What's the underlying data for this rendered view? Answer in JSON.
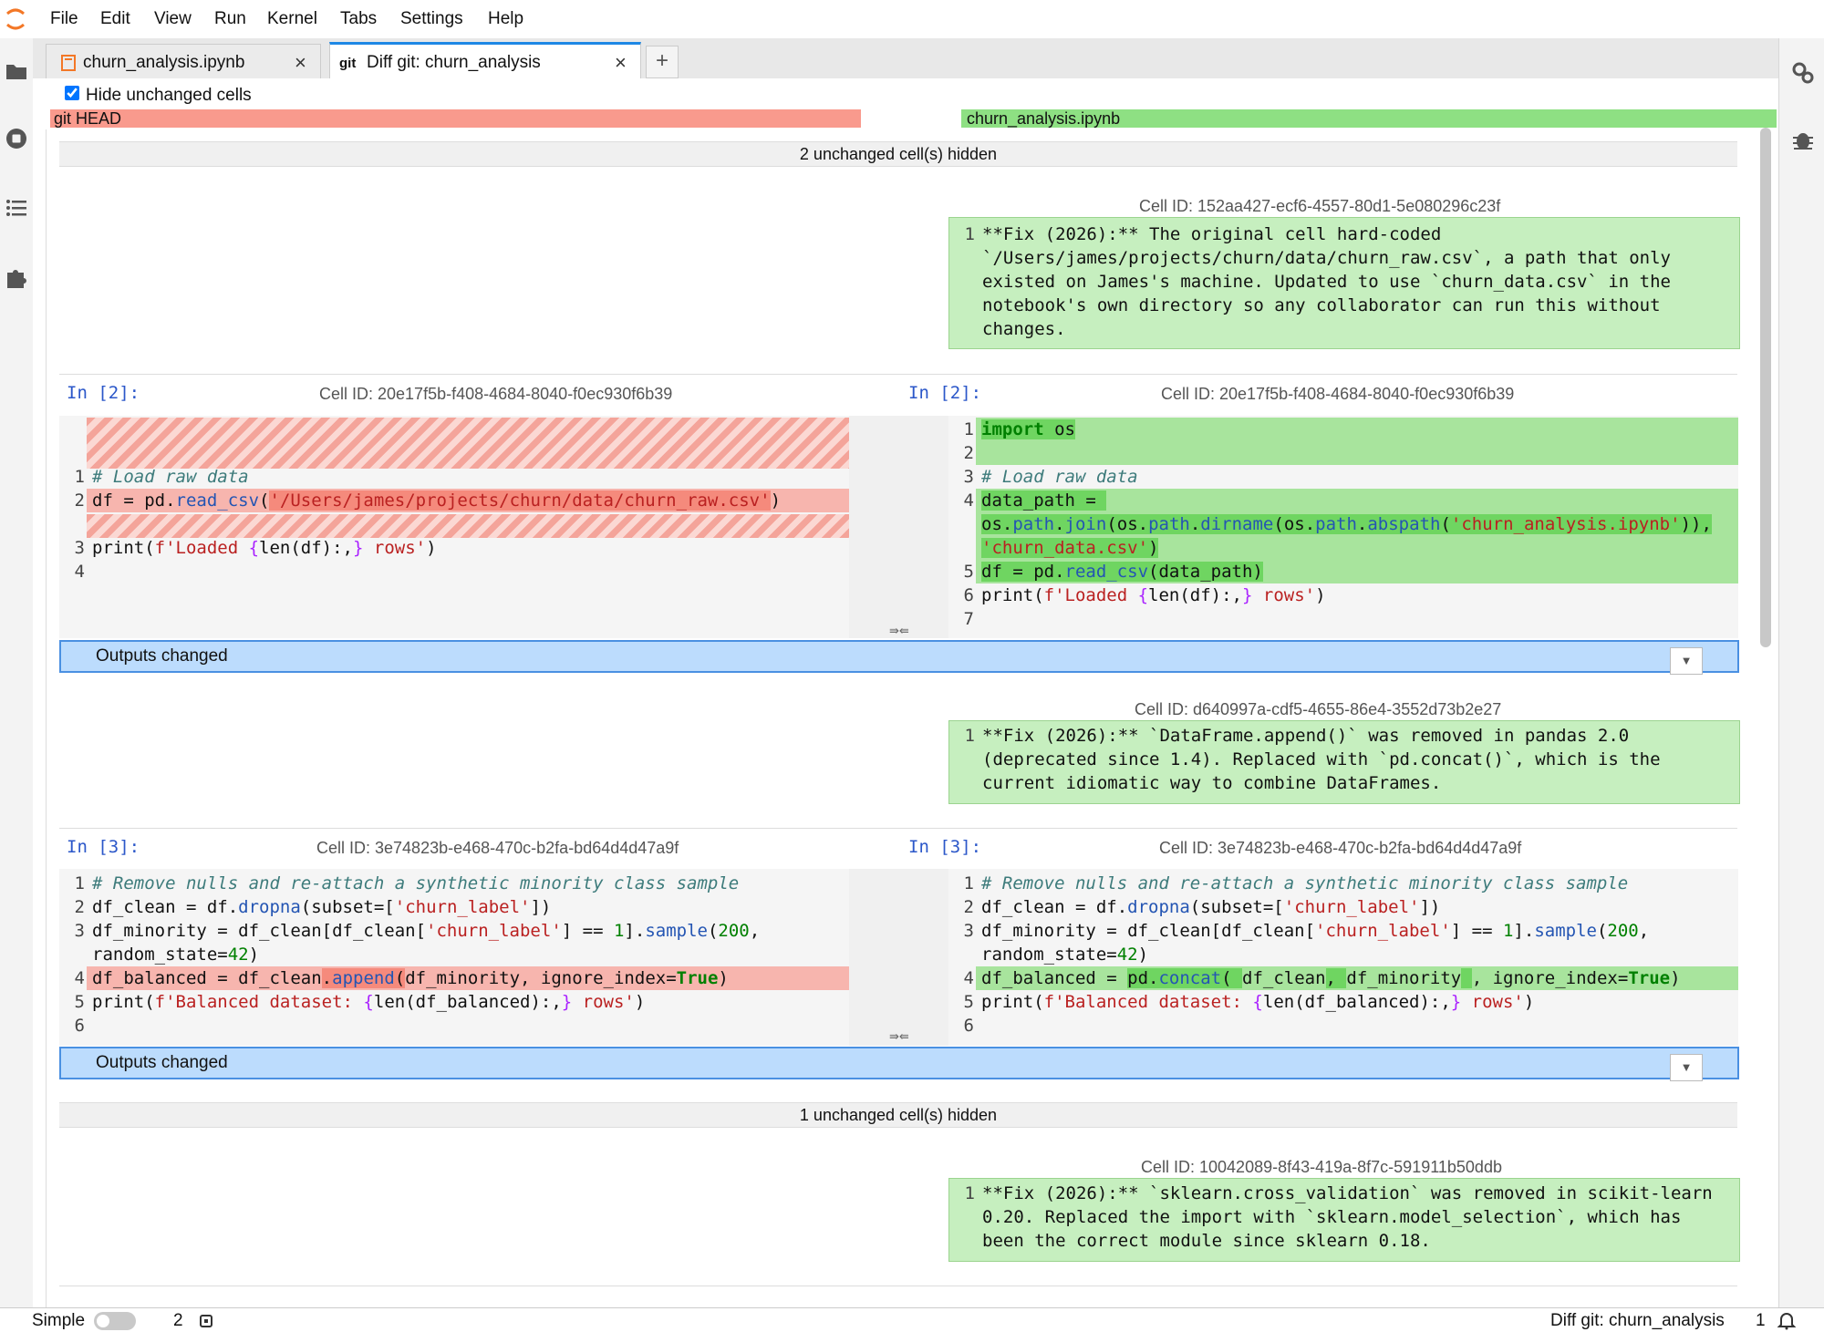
{
  "menu": {
    "items": [
      "File",
      "Edit",
      "View",
      "Run",
      "Kernel",
      "Tabs",
      "Settings",
      "Help"
    ]
  },
  "tabs": [
    {
      "label": "churn_analysis.ipynb",
      "icon": "notebook-icon"
    },
    {
      "label": "Diff git: churn_analysis",
      "icon": "git-icon",
      "prefix": "git"
    }
  ],
  "diff": {
    "hide_unchanged_label": "Hide unchanged cells",
    "hide_unchanged_checked": true,
    "left_header": "git HEAD",
    "right_header": "churn_analysis.ipynb",
    "hidden1": "2 unchanged cell(s) hidden",
    "hidden2": "1 unchanged cell(s) hidden",
    "md1": {
      "cell_id": "Cell ID: 152aa427-ecf6-4557-80d1-5e080296c23f",
      "lines": [
        "**Fix (2026):** The original cell hard-coded",
        "`/Users/james/projects/churn/data/churn_raw.csv`, a path that only",
        "existed on James's machine. Updated to use `churn_data.csv` in the",
        "notebook's own directory so any collaborator can run this without",
        "changes."
      ]
    },
    "cell2": {
      "prompt_left": "In [2]:",
      "prompt_right": "In [2]:",
      "cell_id": "Cell ID: 20e17f5b-f408-4684-8040-f0ec930f6b39",
      "outputs_changed": "Outputs changed"
    },
    "md2": {
      "cell_id": "Cell ID: d640997a-cdf5-4655-86e4-3552d73b2e27",
      "lines": [
        "**Fix (2026):** `DataFrame.append()` was removed in pandas 2.0",
        "(deprecated since 1.4). Replaced with `pd.concat()`, which is the",
        "current idiomatic way to combine DataFrames."
      ]
    },
    "cell3": {
      "prompt_left": "In [3]:",
      "prompt_right": "In [3]:",
      "cell_id": "Cell ID: 3e74823b-e468-470c-b2fa-bd64d4d47a9f",
      "outputs_changed": "Outputs changed"
    },
    "md3": {
      "cell_id": "Cell ID: 10042089-8f43-419a-8f7c-591911b50ddb",
      "lines": [
        "**Fix (2026):** `sklearn.cross_validation` was removed in scikit-learn",
        "0.20. Replaced the import with `sklearn.model_selection`, which has",
        "been the correct module since sklearn 0.18."
      ]
    }
  },
  "status": {
    "mode": "Simple",
    "kernels": "2",
    "doc": "Diff git: churn_analysis",
    "notifications": "1"
  },
  "colors": {
    "removed": "#f99a8d",
    "added": "#8ee083",
    "outputs_bar": "#bcdcfd",
    "accent": "#1e88e5"
  }
}
